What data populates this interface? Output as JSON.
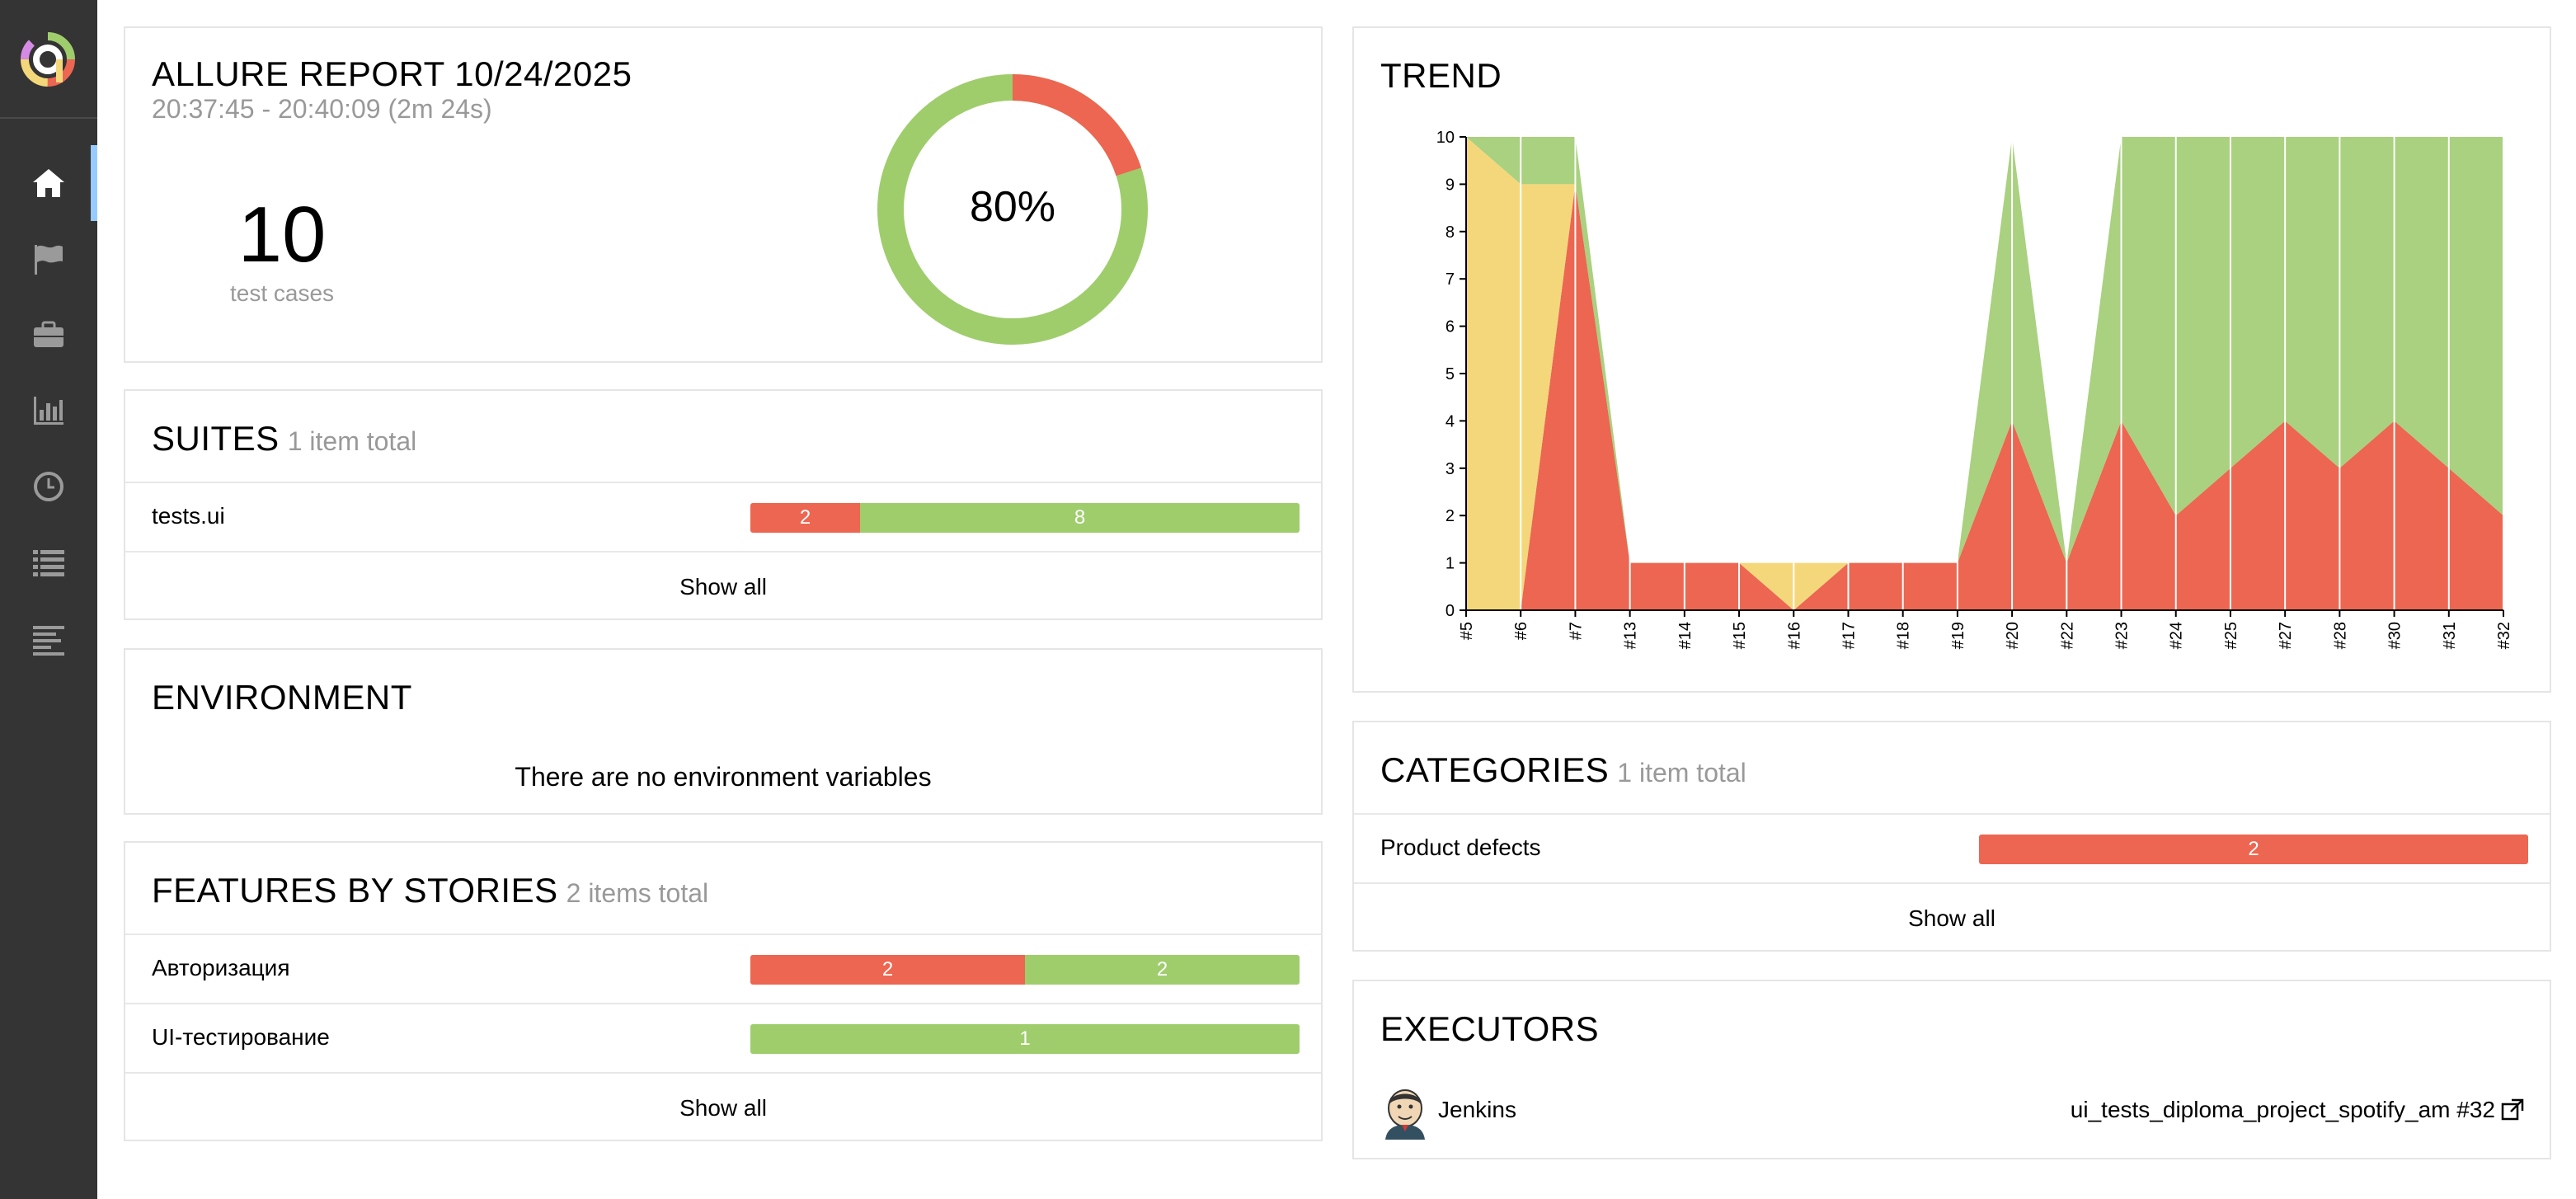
{
  "sidebar": {
    "items": [
      {
        "icon": "home-icon",
        "active": true
      },
      {
        "icon": "flag-icon"
      },
      {
        "icon": "briefcase-icon"
      },
      {
        "icon": "bar-chart-icon"
      },
      {
        "icon": "clock-icon"
      },
      {
        "icon": "list-icon"
      },
      {
        "icon": "timeline-icon"
      }
    ]
  },
  "summary": {
    "title": "ALLURE REPORT 10/24/2025",
    "time": "20:37:45 - 20:40:09 (2m 24s)",
    "count": "10",
    "count_label": "test cases",
    "percent": "80%",
    "donut": {
      "passed": 8,
      "failed": 2
    }
  },
  "suites": {
    "title": "SUITES",
    "subtitle": "1 item total",
    "rows": [
      {
        "label": "tests.ui",
        "failed": 2,
        "passed": 8,
        "failed_label": "2",
        "passed_label": "8"
      }
    ],
    "show_all": "Show all"
  },
  "environment": {
    "title": "ENVIRONMENT",
    "empty_text": "There are no environment variables"
  },
  "features": {
    "title": "FEATURES BY STORIES",
    "subtitle": "2 items total",
    "rows": [
      {
        "label": "Авторизация",
        "failed": 2,
        "passed": 2,
        "failed_label": "2",
        "passed_label": "2"
      },
      {
        "label": "UI-тестирование",
        "failed": 0,
        "passed": 1,
        "failed_label": "",
        "passed_label": "1"
      }
    ],
    "show_all": "Show all"
  },
  "trend": {
    "title": "TREND"
  },
  "chart_data": {
    "type": "area",
    "title": "TREND",
    "xlabel": "",
    "ylabel": "",
    "ylim": [
      0,
      10
    ],
    "y_ticks": [
      "0",
      "1",
      "2",
      "3",
      "4",
      "5",
      "6",
      "7",
      "8",
      "9",
      "10"
    ],
    "categories": [
      "#5",
      "#6",
      "#7",
      "#13",
      "#14",
      "#15",
      "#16",
      "#17",
      "#18",
      "#19",
      "#20",
      "#22",
      "#23",
      "#24",
      "#25",
      "#27",
      "#28",
      "#30",
      "#31",
      "#32"
    ],
    "series": [
      {
        "color": "#ec6651",
        "values": [
          0,
          0,
          9,
          1,
          1,
          1,
          0,
          1,
          1,
          1,
          4,
          1,
          4,
          2,
          3,
          4,
          3,
          4,
          3,
          2
        ]
      },
      {
        "color": "#f5d77b",
        "values": [
          10,
          9,
          0,
          0,
          0,
          0,
          1,
          0,
          0,
          0,
          0,
          0,
          0,
          0,
          0,
          0,
          0,
          0,
          0,
          0
        ]
      },
      {
        "color": "#a9d17f",
        "values": [
          0,
          1,
          1,
          0,
          0,
          0,
          0,
          0,
          0,
          0,
          6,
          0,
          6,
          8,
          7,
          6,
          7,
          6,
          7,
          8
        ]
      }
    ]
  },
  "categories": {
    "title": "CATEGORIES",
    "subtitle": "1 item total",
    "rows": [
      {
        "label": "Product defects",
        "value_label": "2"
      }
    ],
    "show_all": "Show all"
  },
  "executors": {
    "title": "EXECUTORS",
    "name": "Jenkins",
    "build": "ui_tests_diploma_project_spotify_am #32"
  },
  "colors": {
    "failed": "#ec6651",
    "passed": "#9fcd6c",
    "broken": "#f5d77b",
    "sidebar": "#343434"
  }
}
